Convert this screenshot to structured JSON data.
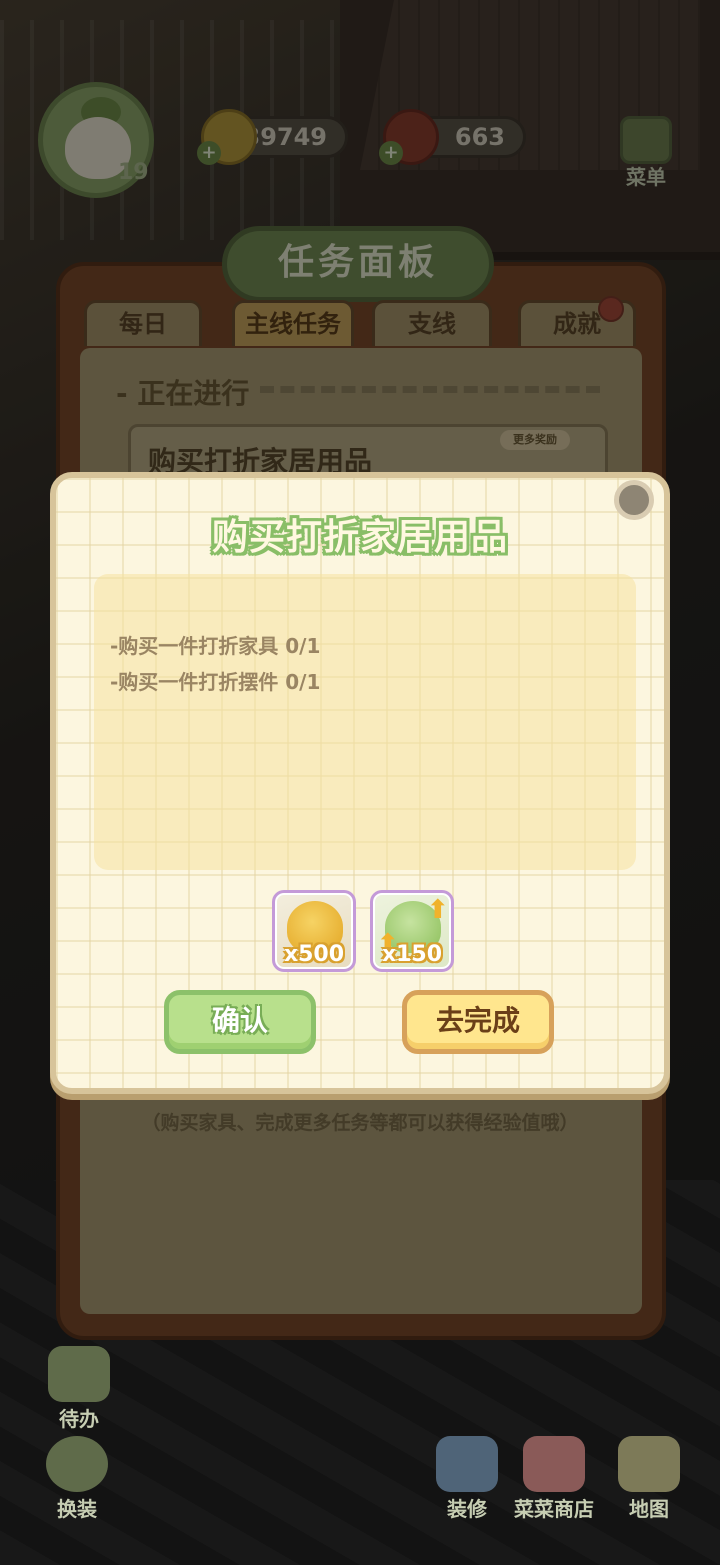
{
  "hud": {
    "level": "19",
    "coins": "39749",
    "meat": "663",
    "menu_label": "菜单"
  },
  "board": {
    "title": "任务面板",
    "tabs": [
      "每日",
      "主线任务",
      "支线",
      "成就"
    ],
    "active_tab": "主线任务",
    "section_label": "- 正在进行",
    "task_title": "购买打折家居用品",
    "more_reward": "更多奖励",
    "hint": "（购买家具、完成更多任务等都可以获得经验值哦）"
  },
  "dialog": {
    "title": "购买打折家居用品",
    "lines": [
      "-购买一件打折家具 0/1",
      "-购买一件打折摆件 0/1"
    ],
    "rewards": [
      {
        "icon": "coin-pile-icon",
        "qty": "x500"
      },
      {
        "icon": "experience-leaf-icon",
        "qty": "x150"
      }
    ],
    "confirm_label": "确认",
    "complete_label": "去完成"
  },
  "nav": {
    "todo": "待办",
    "outfit": "换装",
    "decorate": "装修",
    "shop": "菜菜商店",
    "map": "地图"
  },
  "colors": {
    "title_outline": "#89be67",
    "confirm_button": "#b8e08c",
    "complete_button": "#ffe68e"
  }
}
